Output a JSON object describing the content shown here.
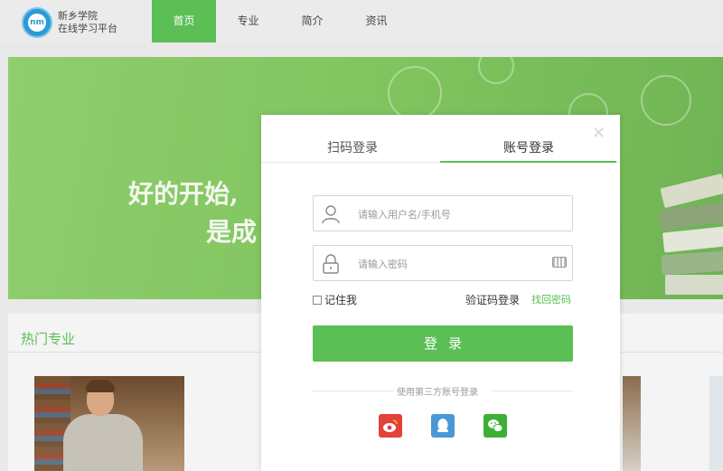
{
  "header": {
    "brand_line1": "新乡学院",
    "brand_line2": "在线学习平台",
    "nav": [
      {
        "label": "首页",
        "active": true
      },
      {
        "label": "专业",
        "active": false
      },
      {
        "label": "简介",
        "active": false
      },
      {
        "label": "资讯",
        "active": false
      }
    ]
  },
  "banner": {
    "slogan_line1": "好的开始,",
    "slogan_line2": "是成"
  },
  "section": {
    "title": "热门专业"
  },
  "login_modal": {
    "tabs": [
      "扫码登录",
      "账号登录"
    ],
    "active_tab": "账号登录",
    "username_placeholder": "请输入用户名/手机号",
    "password_placeholder": "请输入密码",
    "remember_me": "记住我",
    "sms_login": "验证码登录",
    "forgot_password": "找回密码",
    "login_button": "登录",
    "third_party_text": "使用第三方账号登录",
    "social": [
      "weibo-icon",
      "qq-icon",
      "wechat-icon"
    ]
  },
  "colors": {
    "accent": "#5bbf55",
    "weibo": "#e3413b",
    "qq": "#4a98d8",
    "wechat": "#3cb034"
  }
}
